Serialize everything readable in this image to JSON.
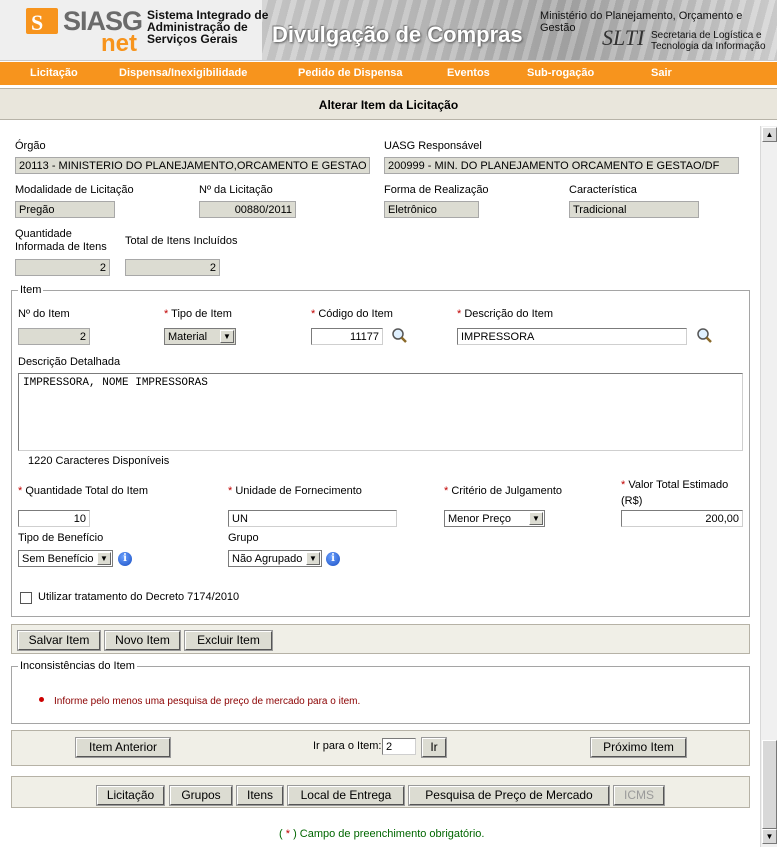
{
  "header": {
    "logo_siasg": "SIASG",
    "logo_net": "net",
    "logo_s": "S",
    "system_name_line1": "Sistema Integrado de",
    "system_name_line2": "Administração de",
    "system_name_line3": "Serviços Gerais",
    "banner_title": "Divulgação de Compras",
    "ministry": "Ministério do Planejamento, Orçamento e Gestão",
    "slti_logo": "SLTI",
    "slti_line1": "Secretaria de Logística e",
    "slti_line2": "Tecnologia da Informação"
  },
  "menu": {
    "licitacao": "Licitação",
    "dispensa": "Dispensa/Inexigibilidade",
    "pedido": "Pedido de Dispensa",
    "eventos": "Eventos",
    "subrogacao": "Sub-rogação",
    "sair": "Sair"
  },
  "page_title": "Alterar Item da Licitação",
  "header_fields": {
    "orgao_label": "Órgão",
    "orgao_value": "20113 - MINISTERIO DO PLANEJAMENTO,ORCAMENTO E GESTAO",
    "uasg_label": "UASG Responsável",
    "uasg_value": "200999 - MIN. DO PLANEJAMENTO ORCAMENTO E GESTAO/DF",
    "modalidade_label": "Modalidade de Licitação",
    "modalidade_value": "Pregão",
    "numero_label": "Nº da Licitação",
    "numero_value": "00880/2011",
    "forma_label": "Forma de Realização",
    "forma_value": "Eletrônico",
    "caracteristica_label": "Característica",
    "caracteristica_value": "Tradicional",
    "qtd_informada_label_1": "Quantidade",
    "qtd_informada_label_2": "Informada de Itens",
    "qtd_informada_value": "2",
    "total_incluidos_label": "Total de Itens Incluídos",
    "total_incluidos_value": "2"
  },
  "item": {
    "legend": "Item",
    "required_mark": "*",
    "numero_label": "Nº do Item",
    "numero_value": "2",
    "tipo_label": "Tipo de Item",
    "tipo_value": "Material",
    "codigo_label": "Código do Item",
    "codigo_value": "11177",
    "descricao_label": "Descrição do Item",
    "descricao_value": "IMPRESSORA",
    "detalhada_label": "Descrição Detalhada",
    "detalhada_value": "IMPRESSORA, NOME IMPRESSORAS",
    "caracteres": "1220 Caracteres Disponíveis",
    "quantidade_label": "Quantidade Total do Item",
    "quantidade_value": "10",
    "unidade_label": "Unidade de Fornecimento",
    "unidade_value": "UN",
    "criterio_label": "Critério de Julgamento",
    "criterio_value": "Menor Preço",
    "valor_label_1": "Valor Total Estimado",
    "valor_label_2": "(R$)",
    "valor_value": "200,00",
    "beneficio_label": "Tipo de Benefício",
    "beneficio_value": "Sem Benefício",
    "grupo_label": "Grupo",
    "grupo_value": "Não Agrupado",
    "decreto_label": "Utilizar tratamento do Decreto 7174/2010",
    "decreto_checked": false
  },
  "actions": {
    "salvar": "Salvar Item",
    "novo": "Novo Item",
    "excluir": "Excluir Item"
  },
  "inconsistencias": {
    "legend": "Inconsistências do Item",
    "message": "Informe pelo menos uma pesquisa de preço de mercado para o item.",
    "bullet_color": "#cc0000"
  },
  "navigation": {
    "anterior": "Item Anterior",
    "ir_para_label": "Ir para o Item:",
    "ir_para_value": "2",
    "ir_button": "Ir",
    "proximo": "Próximo Item"
  },
  "tabs": {
    "licitacao": "Licitação",
    "grupos": "Grupos",
    "itens": "Itens",
    "local": "Local de Entrega",
    "pesquisa": "Pesquisa de Preço de Mercado",
    "icms": "ICMS"
  },
  "footer_note": "( * ) Campo de preenchimento obrigatório.",
  "colors": {
    "menu_orange": "#f7941d",
    "required_red": "#c00000",
    "footer_green": "#006600"
  }
}
